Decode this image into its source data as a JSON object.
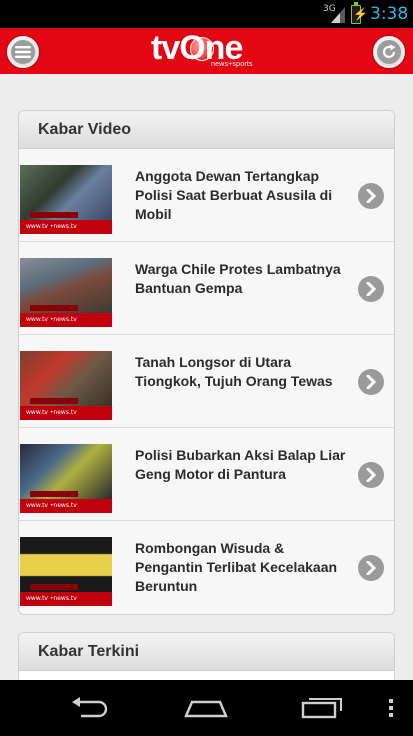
{
  "status_bar": {
    "network": "3G",
    "time": "3:38",
    "icons": [
      "signal-icon",
      "battery-charging-icon"
    ]
  },
  "header": {
    "logo_text": "tvOne",
    "logo_tagline": "news+sports",
    "menu_icon": "menu-icon",
    "refresh_icon": "refresh-icon",
    "brand_color": "#e30613"
  },
  "sections": [
    {
      "title": "Kabar Video",
      "items": [
        {
          "title": "Anggota Dewan Tertangkap Polisi Saat Berbuat Asusila di Mobil",
          "icon": "chevron-right-icon"
        },
        {
          "title": "Warga Chile Protes Lambatnya Bantuan Gempa",
          "icon": "chevron-right-icon"
        },
        {
          "title": "Tanah Longsor di Utara Tiongkok, Tujuh Orang Tewas",
          "icon": "chevron-right-icon"
        },
        {
          "title": "Polisi Bubarkan Aksi Balap Liar Geng Motor di Pantura",
          "icon": "chevron-right-icon"
        },
        {
          "title": "Rombongan Wisuda & Pengantin Terlibat Kecelakaan Beruntun",
          "icon": "chevron-right-icon"
        }
      ]
    },
    {
      "title": "Kabar Terkini",
      "items": []
    }
  ],
  "nav_bar": {
    "icons": [
      "back-icon",
      "home-icon",
      "recent-apps-icon",
      "overflow-menu-icon"
    ]
  }
}
